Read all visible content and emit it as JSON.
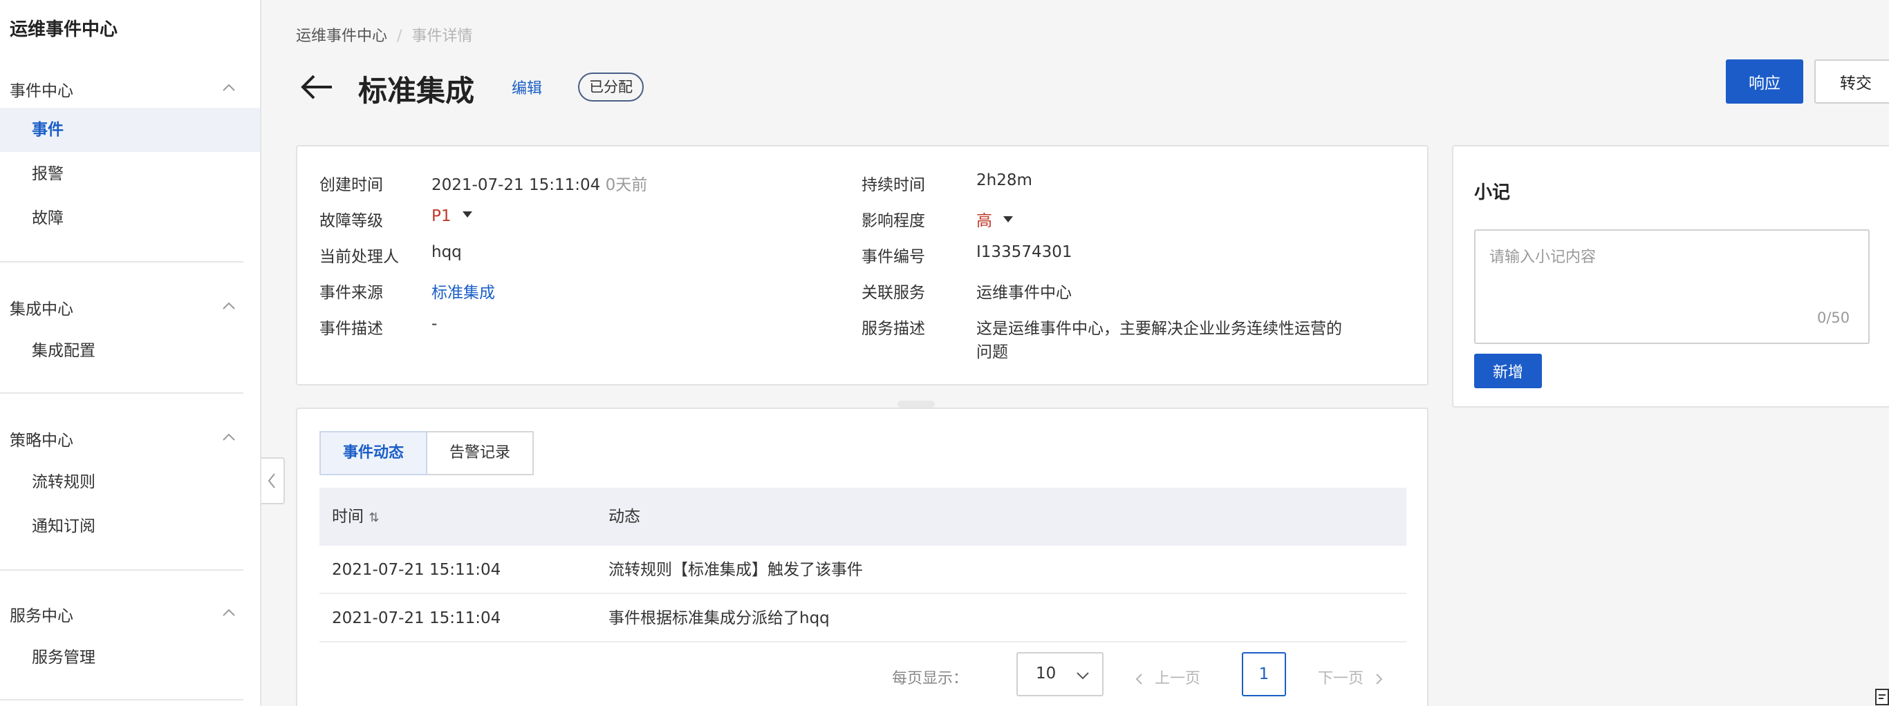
{
  "sidebar": {
    "app_title": "运维事件中心",
    "groups": [
      {
        "title": "事件中心",
        "items": [
          {
            "label": "事件"
          },
          {
            "label": "报警"
          },
          {
            "label": "故障"
          }
        ]
      },
      {
        "title": "集成中心",
        "items": [
          {
            "label": "集成配置"
          }
        ]
      },
      {
        "title": "策略中心",
        "items": [
          {
            "label": "流转规则"
          },
          {
            "label": "通知订阅"
          }
        ]
      },
      {
        "title": "服务中心",
        "items": [
          {
            "label": "服务管理"
          }
        ]
      }
    ],
    "active_item": "事件"
  },
  "breadcrumb": {
    "root": "运维事件中心",
    "sep": "/",
    "current": "事件详情"
  },
  "header": {
    "title": "标准集成",
    "edit_label": "编辑",
    "status": "已分配",
    "respond_label": "响应",
    "transfer_label": "转交"
  },
  "info": {
    "created_label": "创建时间",
    "created_value": "2021-07-21 15:11:04",
    "created_rel": "0天前",
    "level_label": "故障等级",
    "level_value": "P1",
    "handler_label": "当前处理人",
    "handler_value": "hqq",
    "source_label": "事件来源",
    "source_value": "标准集成",
    "desc_label": "事件描述",
    "desc_value": "-",
    "duration_label": "持续时间",
    "duration_value": "2h28m",
    "impact_label": "影响程度",
    "impact_value": "高",
    "number_label": "事件编号",
    "number_value": "I133574301",
    "service_label": "关联服务",
    "service_value": "运维事件中心",
    "service_desc_label": "服务描述",
    "service_desc_line1": "这是运维事件中心，主要解决企业业务连续性运营的",
    "service_desc_line2": "问题"
  },
  "activity": {
    "tabs": [
      {
        "label": "事件动态"
      },
      {
        "label": "告警记录"
      }
    ],
    "columns": {
      "time": "时间",
      "sort_glyph": "⇅",
      "event": "动态"
    },
    "rows": [
      {
        "time": "2021-07-21 15:11:04",
        "event": "流转规则【标准集成】触发了该事件"
      },
      {
        "time": "2021-07-21 15:11:04",
        "event": "事件根据标准集成分派给了hqq"
      }
    ],
    "pager": {
      "page_size_label": "每页显示：",
      "page_size": "10",
      "prev": "上一页",
      "page": "1",
      "next": "下一页"
    }
  },
  "note": {
    "title": "小记",
    "placeholder": "请输入小记内容",
    "count": "0/50",
    "add_label": "新增"
  },
  "colors": {
    "primary": "#1b5cc8",
    "danger": "#c0392b"
  }
}
